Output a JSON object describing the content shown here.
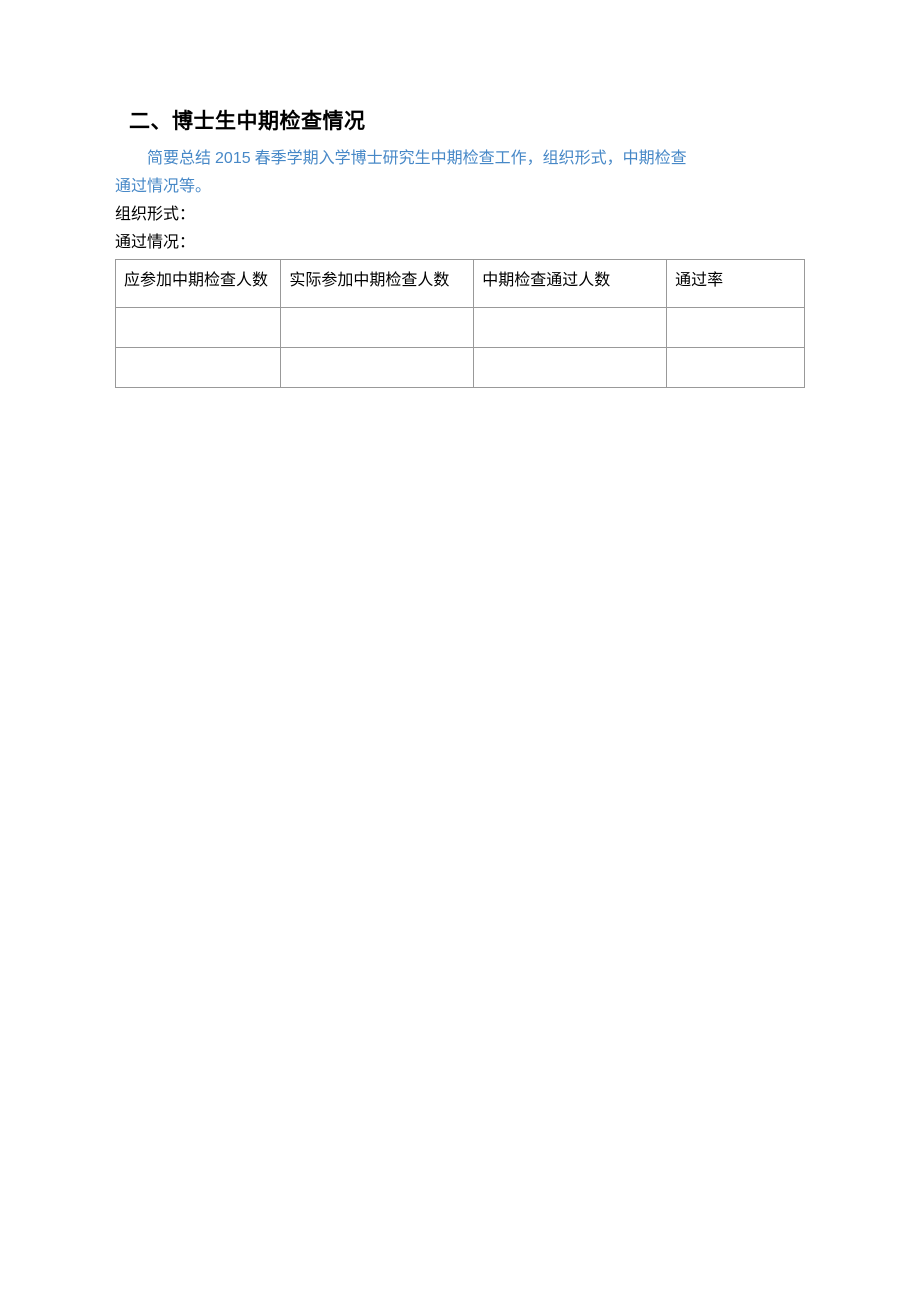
{
  "heading": "二、博士生中期检查情况",
  "intro": {
    "line1_part1": "简要总结 ",
    "year": "2015",
    "line1_part2": " 春季学期入学博士研究生中期检查工作，组织形式，中期检查",
    "line2": "通过情况等。"
  },
  "labels": {
    "org_form": "组织形式：",
    "pass_status": "通过情况："
  },
  "table": {
    "headers": {
      "col1": "应参加中期检查人数",
      "col2": "实际参加中期检查人数",
      "col3": "中期检查通过人数",
      "col4": "通过率"
    },
    "rows": [
      {
        "col1": "",
        "col2": "",
        "col3": "",
        "col4": ""
      },
      {
        "col1": "",
        "col2": "",
        "col3": "",
        "col4": ""
      }
    ]
  }
}
